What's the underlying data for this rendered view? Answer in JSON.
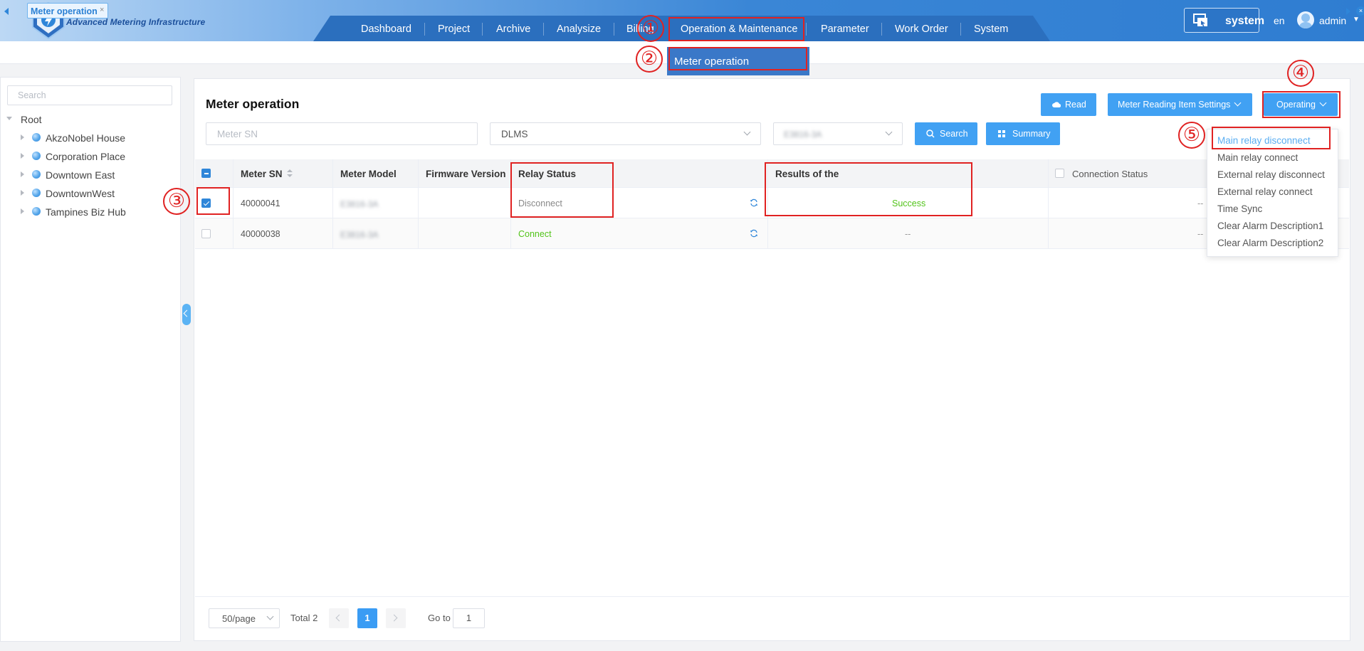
{
  "header": {
    "app_title": "Advanced Metering Infrastructure",
    "nav": [
      "Dashboard",
      "Project",
      "Archive",
      "Analysize",
      "Billing",
      "Operation & Maintenance",
      "Parameter",
      "Work Order",
      "System"
    ],
    "system_button": "system",
    "language": "en",
    "user": "admin"
  },
  "tabs": {
    "active": "Meter operation",
    "close": "×"
  },
  "submenu": {
    "item": "Meter operation"
  },
  "sidebar": {
    "search_placeholder": "Search",
    "root": "Root",
    "items": [
      "AkzoNobel House",
      "Corporation Place",
      "Downtown East",
      "DowntownWest",
      "Tampines Biz Hub"
    ]
  },
  "main": {
    "title": "Meter operation",
    "buttons": {
      "read": "Read",
      "settings": "Meter Reading Item Settings",
      "operating": "Operating",
      "search": "Search",
      "summary": "Summary"
    },
    "filters": {
      "sn_placeholder": "Meter SN",
      "protocol": "DLMS",
      "model": "E3816-3A"
    }
  },
  "table": {
    "headers": {
      "sn": "Meter SN",
      "model": "Meter Model",
      "firmware": "Firmware Version",
      "relay": "Relay Status",
      "result": "Results of the",
      "connection": "Connection Status"
    },
    "rows": [
      {
        "sn": "40000041",
        "model": "E3816-3A",
        "firmware": "",
        "relay": "Disconnect",
        "result": "Success",
        "connection": "--",
        "checked": true
      },
      {
        "sn": "40000038",
        "model": "E3816-3A",
        "firmware": "",
        "relay": "Connect",
        "result": "--",
        "connection": "--",
        "checked": false
      }
    ]
  },
  "dropdown": [
    "Main relay disconnect",
    "Main relay connect",
    "External relay disconnect",
    "External relay connect",
    "Time Sync",
    "Clear Alarm Description1",
    "Clear Alarm Description2"
  ],
  "pagination": {
    "size": "50/page",
    "total": "Total 2",
    "current": "1",
    "goto_label": "Go to",
    "goto_value": "1"
  },
  "annotations": [
    "①",
    "②",
    "③",
    "④",
    "⑤"
  ],
  "colors": {
    "primary": "#41a1f3",
    "success": "#52c41a",
    "annotation": "#e02222",
    "header_dark": "#2b6fbe"
  }
}
